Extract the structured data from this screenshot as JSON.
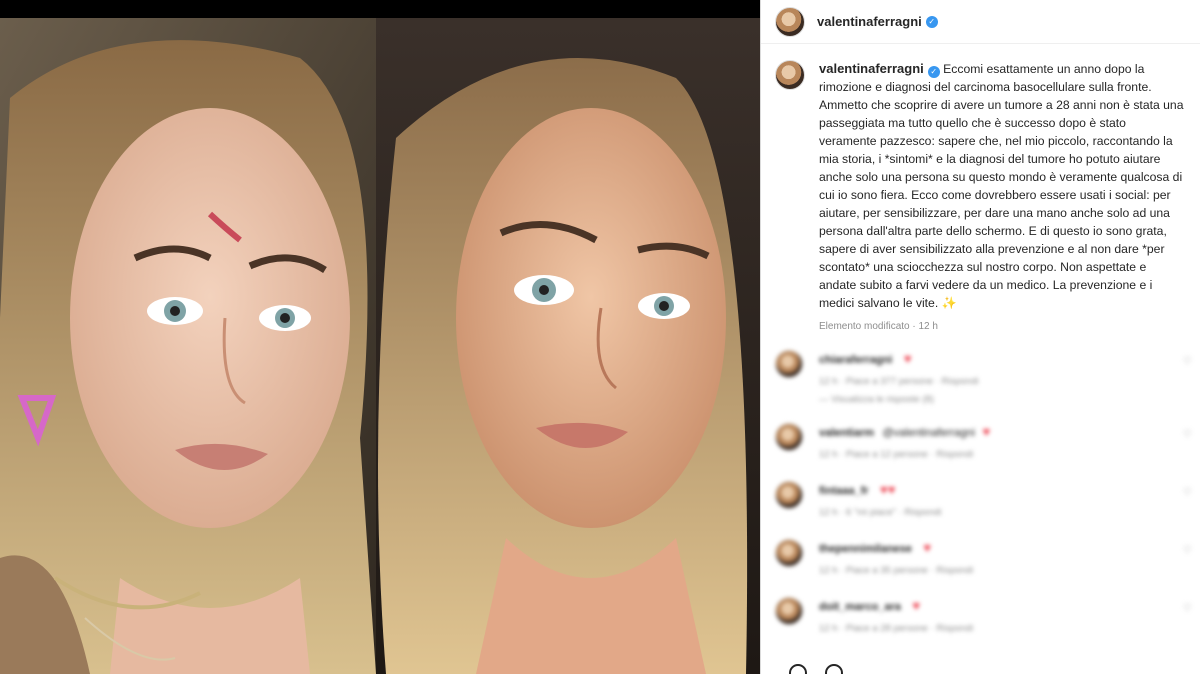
{
  "post": {
    "username": "valentinaferragni",
    "verified_icon": "verified-badge-icon",
    "caption": "Eccomi esattamente un anno dopo la rimozione e diagnosi del carcinoma basocellulare sulla fronte. Ammetto che scoprire di avere un tumore a 28 anni non è stata una passeggiata ma tutto quello che è successo dopo è stato veramente pazzesco: sapere che, nel mio piccolo, raccontando la mia storia, i *sintomi* e la diagnosi del tumore ho potuto aiutare anche solo una persona su questo mondo è veramente qualcosa di cui io sono fiera. Ecco come dovrebbero essere usati i social: per aiutare, per sensibilizzare, per dare una mano anche solo ad una persona dall'altra parte dello schermo. E di questo io sono grata, sapere di aver sensibilizzato alla prevenzione e al non dare *per scontato* una sciocchezza sul nostro corpo. Non aspettate e andate subito a farvi vedere da un medico. La prevenzione e i medici salvano le vite. ✨",
    "edited_label": "Elemento modificato",
    "time": "12 h"
  },
  "comments": [
    {
      "username": "chiaraferragni",
      "text": "",
      "hearts": "♥",
      "meta": "12 h · Piace a 377 persone · Rispondi"
    },
    {
      "username": "valentiarm",
      "text": "@valentinaferragni",
      "hearts": "♥",
      "meta": "12 h · Piace a 12 persone · Rispondi"
    },
    {
      "username": "fintaaa_fr",
      "text": "",
      "hearts": "♥♥",
      "meta": "12 h · 6 \"mi piace\" · Rispondi"
    },
    {
      "username": "thepennimilanese",
      "text": "",
      "hearts": "♥",
      "meta": "12 h · Piace a 35 persone · Rispondi"
    },
    {
      "username": "doit_marco_ara",
      "text": "",
      "hearts": "♥",
      "meta": "12 h · Piace a 28 persone · Rispondi"
    }
  ],
  "view_replies": "— Visualizza le risposte (8)",
  "colors": {
    "verified": "#3897f0",
    "heart": "#ed4956",
    "muted": "#8e8e8e",
    "text": "#262626"
  }
}
